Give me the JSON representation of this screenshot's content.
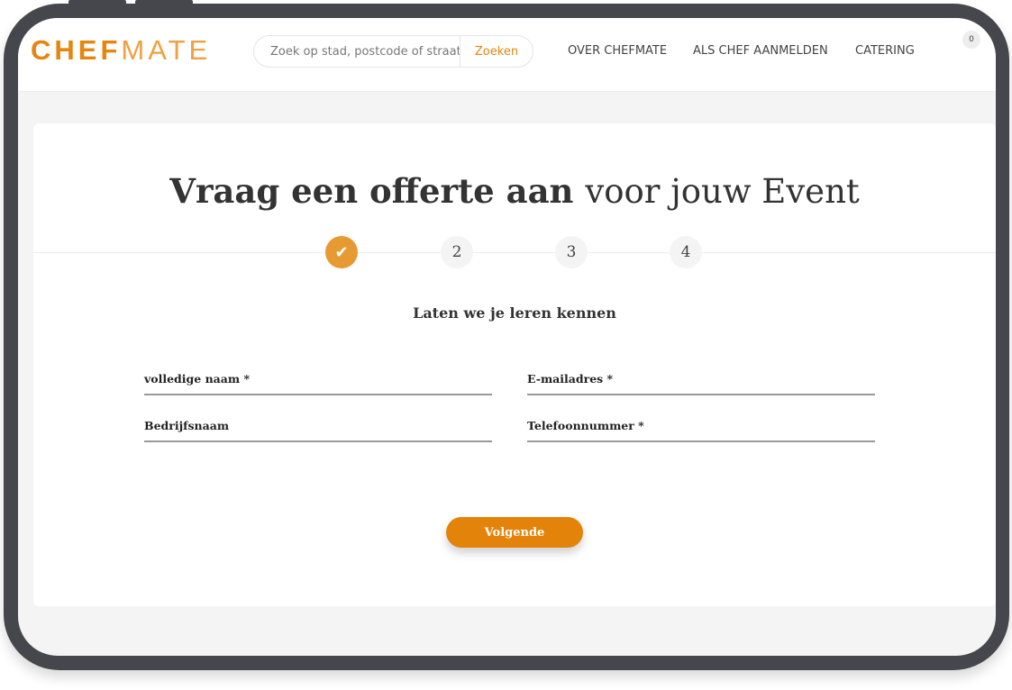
{
  "colors": {
    "accent": "#e4830a",
    "frame": "#46474c",
    "step_done": "#e89a32"
  },
  "header": {
    "logo": {
      "bold": "CHEF",
      "light": "MATE"
    },
    "search": {
      "placeholder": "Zoek op stad, postcode of straat",
      "button": "Zoeken"
    },
    "nav": [
      "OVER CHEFMATE",
      "ALS CHEF AANMELDEN",
      "CATERING"
    ],
    "cart_count": "0"
  },
  "main": {
    "title_bold": "Vraag een offerte aan",
    "title_rest": "voor jouw Event",
    "steps": [
      {
        "label": "✔",
        "icon": "check-icon",
        "state": "done"
      },
      {
        "label": "2"
      },
      {
        "label": "3"
      },
      {
        "label": "4"
      }
    ],
    "subtitle": "Laten we je leren kennen",
    "fields": [
      {
        "label": "volledige naam *"
      },
      {
        "label": "E-mailadres *"
      },
      {
        "label": "Bedrijfsnaam"
      },
      {
        "label": "Telefoonnummer *"
      }
    ],
    "next_button": "Volgende"
  }
}
